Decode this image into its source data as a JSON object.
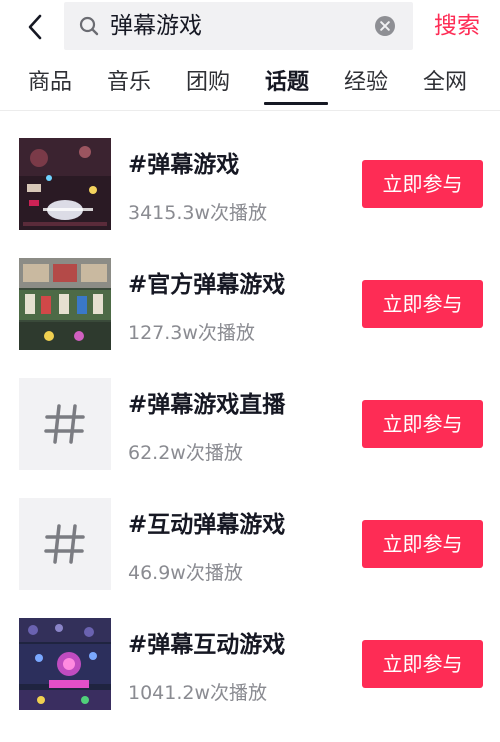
{
  "search": {
    "query": "弹幕游戏",
    "submit_label": "搜索"
  },
  "tabs": [
    {
      "label": "商品",
      "active": false
    },
    {
      "label": "音乐",
      "active": false
    },
    {
      "label": "团购",
      "active": false
    },
    {
      "label": "话题",
      "active": true
    },
    {
      "label": "经验",
      "active": false
    },
    {
      "label": "全网",
      "active": false
    }
  ],
  "results": [
    {
      "title": "#弹幕游戏",
      "plays": "3415.3w次播放",
      "button_label": "立即参与",
      "thumb_type": "image"
    },
    {
      "title": "#官方弹幕游戏",
      "plays": "127.3w次播放",
      "button_label": "立即参与",
      "thumb_type": "image"
    },
    {
      "title": "#弹幕游戏直播",
      "plays": "62.2w次播放",
      "button_label": "立即参与",
      "thumb_type": "hashtag",
      "thumb_symbol": "#"
    },
    {
      "title": "#互动弹幕游戏",
      "plays": "46.9w次播放",
      "button_label": "立即参与",
      "thumb_type": "hashtag",
      "thumb_symbol": "#"
    },
    {
      "title": "#弹幕互动游戏",
      "plays": "1041.2w次播放",
      "button_label": "立即参与",
      "thumb_type": "image"
    }
  ],
  "colors": {
    "accent": "#fe2c55",
    "text_primary": "#161823",
    "text_secondary": "#8a8b91",
    "search_bg": "#f1f1f3"
  }
}
